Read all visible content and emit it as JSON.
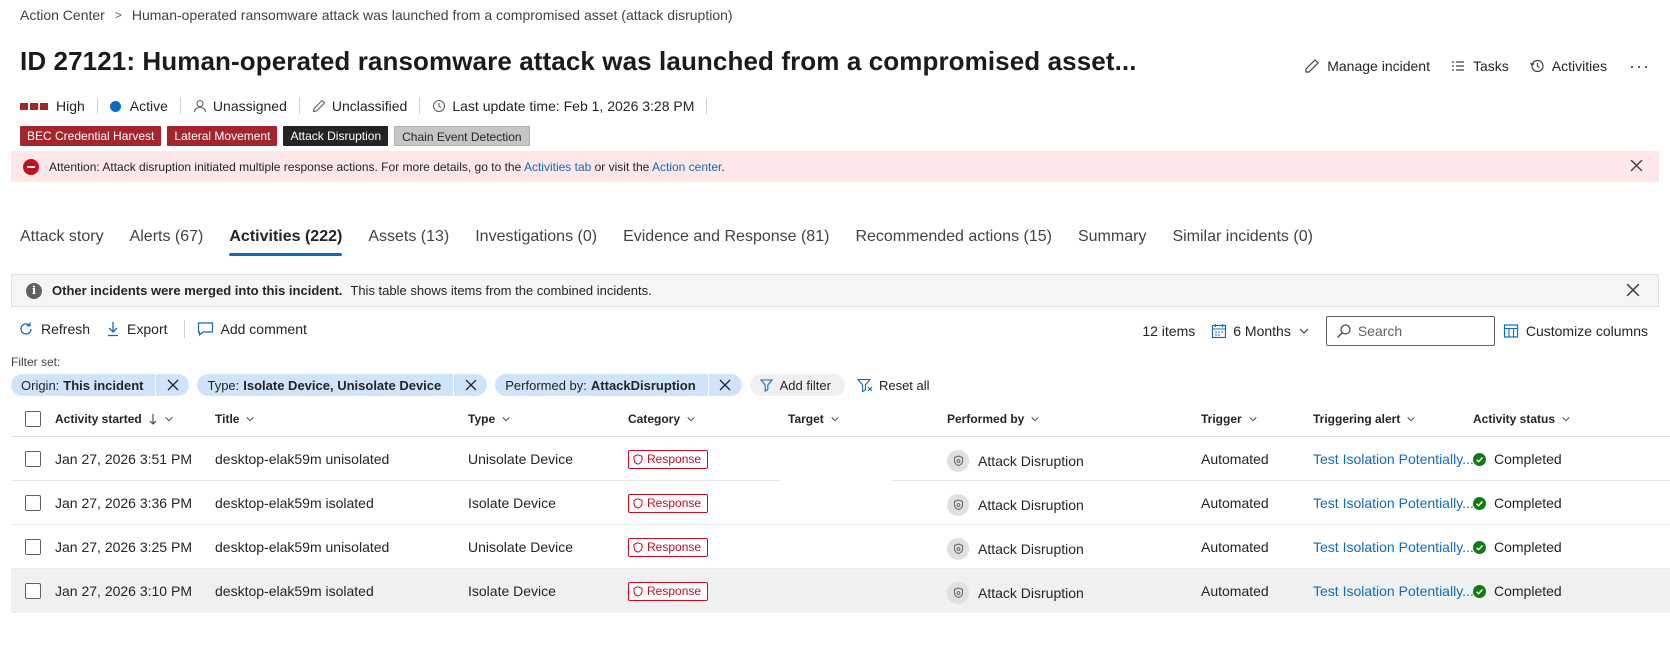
{
  "breadcrumb": {
    "root": "Action Center",
    "current": "Human-operated ransomware attack was launched from a compromised asset (attack disruption)"
  },
  "title": "ID 27121: Human-operated ransomware attack was launched from a compromised asset...",
  "header_actions": {
    "manage": "Manage incident",
    "tasks": "Tasks",
    "activities": "Activities",
    "more": "···"
  },
  "meta": {
    "severity": "High",
    "status": "Active",
    "assigned": "Unassigned",
    "classification": "Unclassified",
    "last_update": "Last update time: Feb 1, 2026 3:28 PM"
  },
  "tags": [
    "BEC Credential Harvest",
    "Lateral Movement",
    "Attack Disruption",
    "Chain Event Detection"
  ],
  "banner": {
    "text1": "Attention: Attack disruption initiated multiple response actions. For more details, go to the ",
    "link1": "Activities tab",
    "text2": " or visit the ",
    "link2": "Action center",
    "text3": "."
  },
  "tabs": [
    "Attack story",
    "Alerts (67)",
    "Activities (222)",
    "Assets (13)",
    "Investigations (0)",
    "Evidence and Response (81)",
    "Recommended actions (15)",
    "Summary",
    "Similar incidents (0)"
  ],
  "active_tab_index": 2,
  "info_banner": {
    "bold": "Other incidents were merged into this incident.",
    "text": "This table shows items from the combined incidents."
  },
  "toolbar": {
    "refresh": "Refresh",
    "export": "Export",
    "add_comment": "Add comment"
  },
  "list_tools": {
    "count": "12 items",
    "range": "6 Months",
    "search_placeholder": "Search",
    "customize": "Customize columns"
  },
  "filter_set_label": "Filter set:",
  "filters": [
    {
      "key": "Origin:",
      "value": "This incident"
    },
    {
      "key": "Type:",
      "value": "Isolate Device, Unisolate Device"
    },
    {
      "key": "Performed by:",
      "value": "AttackDisruption"
    }
  ],
  "filter_actions": {
    "add": "Add filter",
    "reset": "Reset all"
  },
  "columns": [
    "Activity started",
    "Title",
    "Type",
    "Category",
    "Target",
    "Performed by",
    "Trigger",
    "Triggering alert",
    "Activity status"
  ],
  "rows": [
    {
      "started": "Jan 27, 2026 3:51 PM",
      "title": "desktop-elak59m unisolated",
      "type": "Unisolate Device",
      "category": "Response",
      "target": "",
      "performed_by": "Attack Disruption",
      "trigger": "Automated",
      "alert": "Test Isolation Potentially...",
      "status": "Completed"
    },
    {
      "started": "Jan 27, 2026 3:36 PM",
      "title": "desktop-elak59m isolated",
      "type": "Isolate Device",
      "category": "Response",
      "target": "",
      "performed_by": "Attack Disruption",
      "trigger": "Automated",
      "alert": "Test Isolation Potentially...",
      "status": "Completed"
    },
    {
      "started": "Jan 27, 2026 3:25 PM",
      "title": "desktop-elak59m unisolated",
      "type": "Unisolate Device",
      "category": "Response",
      "target": "",
      "performed_by": "Attack Disruption",
      "trigger": "Automated",
      "alert": "Test Isolation Potentially...",
      "status": "Completed"
    },
    {
      "started": "Jan 27, 2026 3:10 PM",
      "title": "desktop-elak59m isolated",
      "type": "Isolate Device",
      "category": "Response",
      "target": "",
      "performed_by": "Attack Disruption",
      "trigger": "Automated",
      "alert": "Test Isolation Potentially...",
      "status": "Completed"
    }
  ],
  "colors": {
    "accent": "#0f6cbd",
    "severity": "#a4262c",
    "response": "#c50f1f",
    "success": "#107c10",
    "banner_bg": "#fde7e9"
  }
}
